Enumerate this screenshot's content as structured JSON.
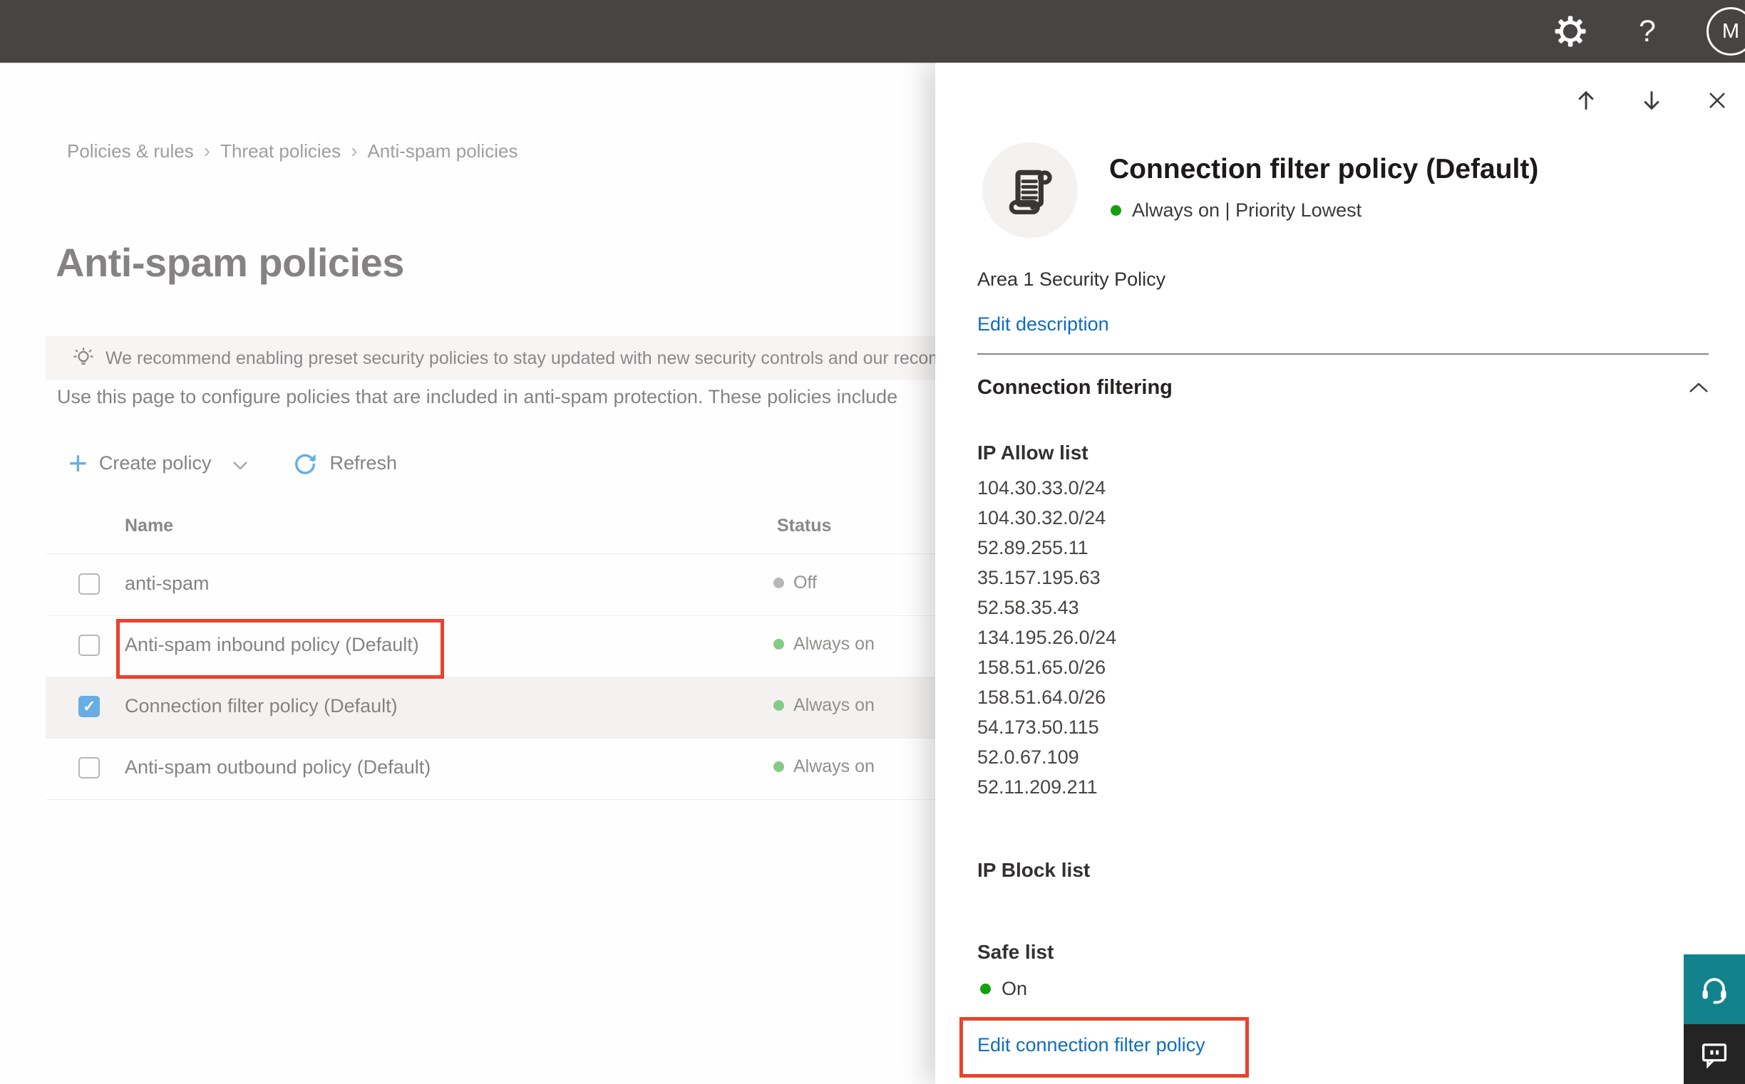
{
  "topbar": {
    "avatar_initial": "M",
    "help_label": "?"
  },
  "main": {
    "breadcrumb": {
      "items": [
        "Policies & rules",
        "Threat policies",
        "Anti-spam policies"
      ],
      "separator": "›"
    },
    "title": "Anti-spam policies",
    "banner": {
      "text": "We recommend enabling preset security policies to stay updated with new security controls and our recomme"
    },
    "description": "Use this page to configure policies that are included in anti-spam protection. These policies include",
    "toolbar": {
      "create_policy": "Create policy",
      "refresh": "Refresh"
    },
    "table": {
      "columns": [
        "Name",
        "Status"
      ],
      "rows": [
        {
          "name": "anti-spam",
          "status": "Off",
          "enabled": false,
          "checked": false,
          "selected": false
        },
        {
          "name": "Anti-spam inbound policy (Default)",
          "status": "Always on",
          "enabled": true,
          "checked": false,
          "selected": false
        },
        {
          "name": "Connection filter policy (Default)",
          "status": "Always on",
          "enabled": true,
          "checked": true,
          "selected": true
        },
        {
          "name": "Anti-spam outbound policy (Default)",
          "status": "Always on",
          "enabled": true,
          "checked": false,
          "selected": false
        }
      ]
    }
  },
  "flyout": {
    "title": "Connection filter policy (Default)",
    "status_line": "Always on | Priority Lowest",
    "description": "Area 1 Security Policy",
    "edit_description_label": "Edit description",
    "section_heading": "Connection filtering",
    "ip_allow": {
      "label": "IP Allow list",
      "ips": [
        "104.30.33.0/24",
        "104.30.32.0/24",
        "52.89.255.11",
        "35.157.195.63",
        "52.58.35.43",
        "134.195.26.0/24",
        "158.51.65.0/26",
        "158.51.64.0/26",
        "54.173.50.115",
        "52.0.67.109",
        "52.11.209.211"
      ]
    },
    "ip_block": {
      "label": "IP Block list"
    },
    "safe_list": {
      "label": "Safe list",
      "status": "On"
    },
    "edit_link_label": "Edit connection filter policy"
  },
  "colors": {
    "link_blue": "#0f6cbd",
    "accent_blue": "#0078d4",
    "status_green_bright": "#13a10e",
    "status_green_muted": "#34a838",
    "status_gray": "#8a8886",
    "annotation_red": "#e8432c",
    "help_teal": "#12838d",
    "topbar_gray": "#474543"
  }
}
